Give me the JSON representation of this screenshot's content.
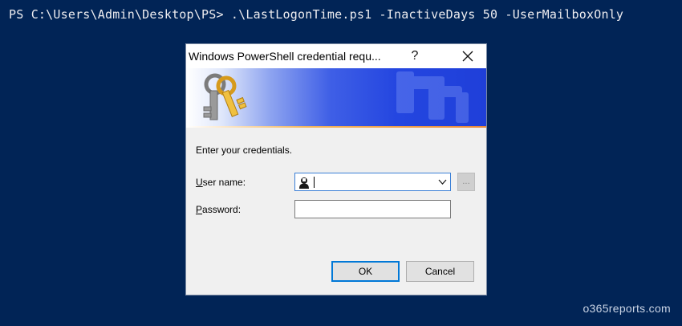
{
  "console": {
    "command_line": "PS C:\\Users\\Admin\\Desktop\\PS> .\\LastLogonTime.ps1 -InactiveDays 50 -UserMailboxOnly"
  },
  "watermark": "o365reports.com",
  "dialog": {
    "title": "Windows PowerShell credential requ...",
    "help_label": "?",
    "prompt": "Enter your credentials.",
    "username_label_accel": "U",
    "username_label_rest": "ser name:",
    "username_value": "",
    "password_label_accel": "P",
    "password_label_rest": "assword:",
    "password_value": "",
    "browse_label": "...",
    "ok_label": "OK",
    "cancel_label": "Cancel"
  },
  "colors": {
    "console_background": "#012456",
    "dialog_background": "#f0f0f0",
    "banner_blue": "#2446e0",
    "focus_accent": "#0078d7"
  },
  "icons": [
    "keys-icon",
    "user-icon",
    "chevron-down-icon",
    "close-icon",
    "help-icon"
  ]
}
